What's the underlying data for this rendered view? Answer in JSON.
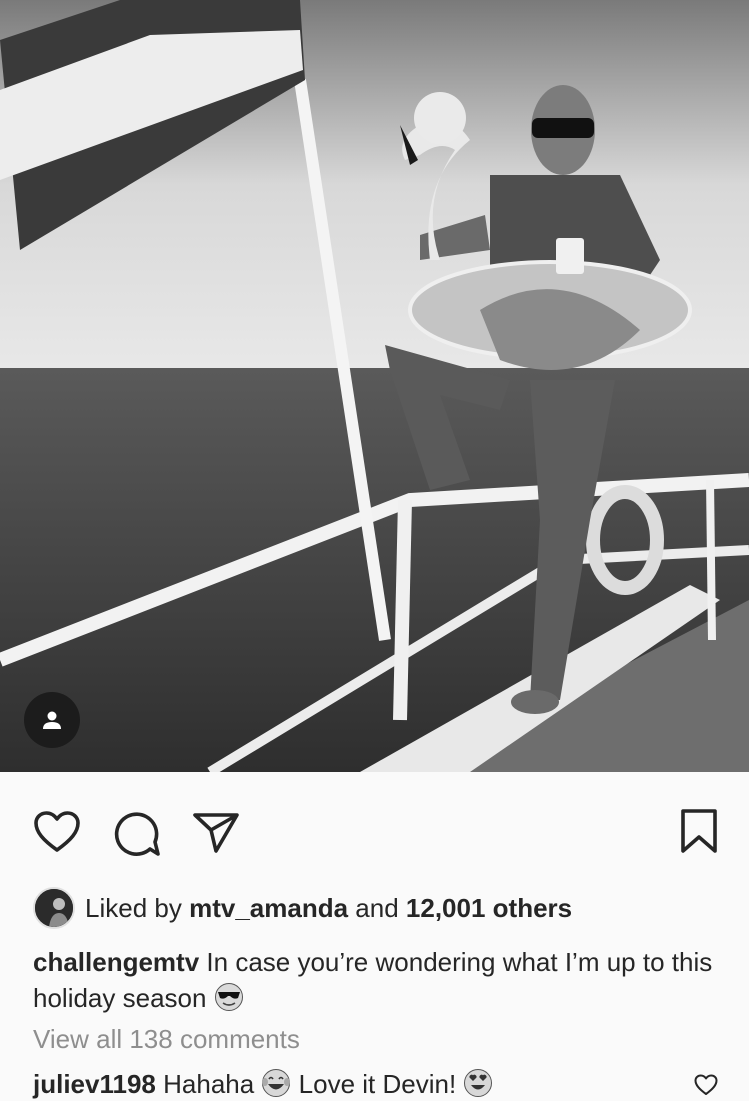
{
  "post": {
    "photo_alt": "Man posing with flamingo float on boat",
    "likes": {
      "prefix": "Liked by",
      "user": "mtv_amanda",
      "middle": "and",
      "count_text": "12,001 others"
    },
    "caption": {
      "username": "challengemtv",
      "text": "In case you’re wondering what I’m up to this holiday season"
    },
    "view_all_comments": "View all 138 comments",
    "comment": {
      "username": "juliev1198",
      "text_part1": "Hahaha",
      "text_part2": "Love it Devin!"
    }
  },
  "icons": {
    "like": "heart-icon",
    "comment": "comment-bubble-icon",
    "share": "paper-plane-icon",
    "save": "bookmark-icon",
    "tag": "user-tag-icon",
    "comment_like": "small-heart-icon"
  },
  "colors": {
    "text": "#262626",
    "muted": "#8e8e8e",
    "background": "#fafafa"
  }
}
